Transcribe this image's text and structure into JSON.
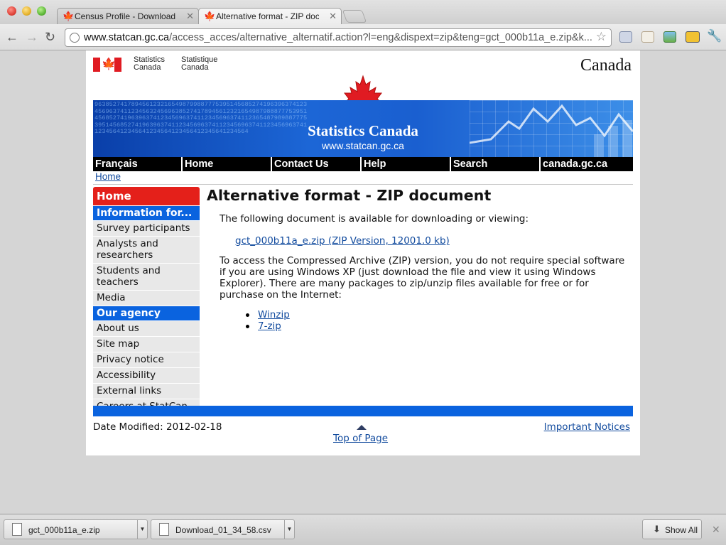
{
  "browser": {
    "tabs": [
      {
        "title": "Census Profile - Download fi",
        "active": false
      },
      {
        "title": "Alternative format - ZIP docu",
        "active": true
      }
    ],
    "url_host": "www.statcan.gc.ca",
    "url_path": "/access_acces/alternative_alternatif.action?l=eng&dispext=zip&teng=gct_000b11a_e.zip&k..."
  },
  "header": {
    "sig_en_1": "Statistics",
    "sig_en_2": "Canada",
    "sig_fr_1": "Statistique",
    "sig_fr_2": "Canada",
    "wordmark": "Canada",
    "banner_title": "Statistics Canada",
    "banner_url": "www.statcan.gc.ca",
    "banner_digits": "9638527417894561232165498799887775395145685274196396374123456963741123456324569638527417894561232165498798887775395145685274196396374123456963741123456963741123654879898877753951456852741963963741123456963741123456963741123456963741123456412345641234564123456412345641234564"
  },
  "nav": [
    "Français",
    "Home",
    "Contact Us",
    "Help",
    "Search",
    "canada.gc.ca"
  ],
  "breadcrumb": "Home",
  "leftnav": {
    "home": "Home",
    "section1": "Information for...",
    "items1": [
      "Survey participants",
      "Analysts and researchers",
      "Students and teachers",
      "Media"
    ],
    "section2": "Our agency",
    "items2": [
      "About us",
      "Site map",
      "Privacy notice",
      "Accessibility",
      "External links",
      "Careers at StatCan"
    ]
  },
  "main": {
    "title": "Alternative format - ZIP document",
    "intro": "The following document is available for downloading or viewing:",
    "download_link": "gct_000b11a_e.zip (ZIP Version, 12001.0 kb)",
    "body": "To access the Compressed Archive (ZIP) version, you do not require special software if you are using Windows XP (just download the file and view it using Windows Explorer). There are many packages to zip/unzip files available for free or for purchase on the Internet:",
    "packages": [
      "Winzip",
      "7-zip"
    ]
  },
  "footer": {
    "date_modified": "Date Modified: 2012-02-18",
    "top_of_page": "Top of Page",
    "important_notices": "Important Notices"
  },
  "downloads": {
    "items": [
      "gct_000b11a_e.zip",
      "Download_01_34_58.csv"
    ],
    "show_all": "Show All"
  }
}
